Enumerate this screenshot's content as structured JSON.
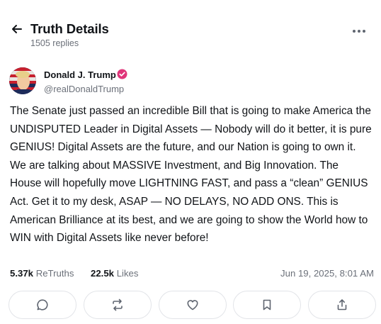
{
  "header": {
    "title": "Truth Details",
    "replies": "1505 replies",
    "back_icon": "arrow-left-icon",
    "more_icon": "ellipsis-icon"
  },
  "author": {
    "name": "Donald J. Trump",
    "handle": "@realDonaldTrump",
    "verified_color": "#e0357a"
  },
  "post": {
    "text": "The Senate just passed an incredible Bill that is going to make America the UNDISPUTED Leader in Digital Assets — Nobody will do it better, it is pure GENIUS! Digital Assets are the future, and our Nation is going to own it. We are talking about MASSIVE Investment, and Big Innovation. The House will hopefully move LIGHTNING FAST, and pass a “clean” GENIUS Act. Get it to my desk, ASAP — NO DELAYS, NO ADD ONS. This is American Brilliance at its best, and we are going to show the World how to WIN with Digital Assets like never before!"
  },
  "stats": {
    "retruths_count": "5.37k",
    "retruths_label": "ReTruths",
    "likes_count": "22.5k",
    "likes_label": "Likes",
    "timestamp": "Jun 19, 2025, 8:01 AM"
  },
  "actions": [
    {
      "icon": "reply-icon"
    },
    {
      "icon": "retruth-icon"
    },
    {
      "icon": "like-icon"
    },
    {
      "icon": "bookmark-icon"
    },
    {
      "icon": "share-icon"
    }
  ]
}
